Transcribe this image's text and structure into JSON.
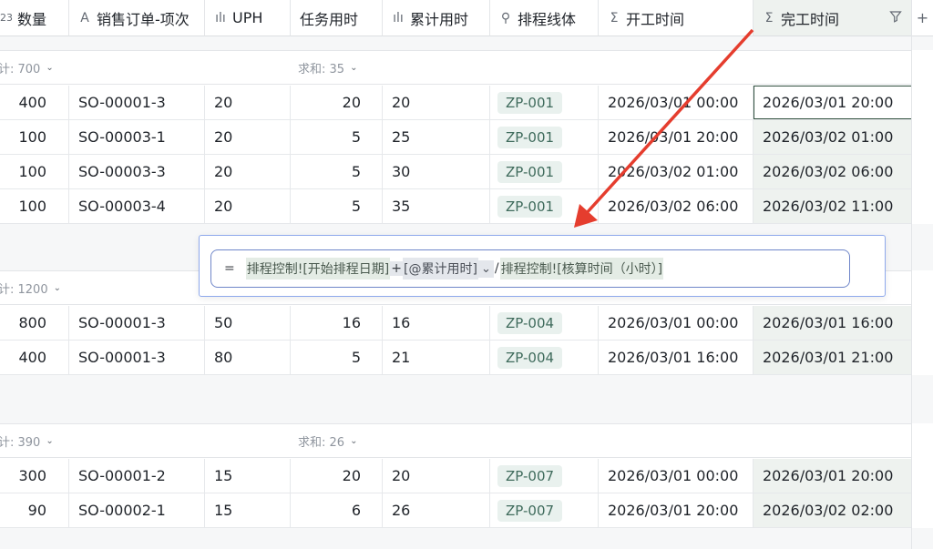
{
  "columns": [
    {
      "icon": "123",
      "icon_name": "number-icon",
      "label": "数量"
    },
    {
      "icon": "A",
      "icon_name": "text-icon",
      "label": "销售订单-项次"
    },
    {
      "icon": "ılı",
      "icon_name": "bar-chart-icon",
      "label": "UPH"
    },
    {
      "icon": "",
      "icon_name": "",
      "label": "任务用时"
    },
    {
      "icon": "ılı",
      "icon_name": "bar-chart-icon",
      "label": "累计用时"
    },
    {
      "icon": "⚲",
      "icon_name": "link-icon",
      "label": "排程线体"
    },
    {
      "icon": "Σ",
      "icon_name": "sigma-icon",
      "label": "开工时间"
    },
    {
      "icon": "Σ",
      "icon_name": "sigma-icon",
      "label": "完工时间"
    }
  ],
  "groups": [
    {
      "sum_qty": "计: 700",
      "sum_time": "求和: 35",
      "rows": [
        {
          "qty": "400",
          "order": "SO-00001-3",
          "uph": "20",
          "task": "20",
          "cum": "20",
          "line": "ZP-001",
          "start": "2026/03/01 00:00",
          "end": "2026/03/01 20:00"
        },
        {
          "qty": "100",
          "order": "SO-00003-1",
          "uph": "20",
          "task": "5",
          "cum": "25",
          "line": "ZP-001",
          "start": "2026/03/01 20:00",
          "end": "2026/03/02 01:00"
        },
        {
          "qty": "100",
          "order": "SO-00003-3",
          "uph": "20",
          "task": "5",
          "cum": "30",
          "line": "ZP-001",
          "start": "2026/03/02 01:00",
          "end": "2026/03/02 06:00"
        },
        {
          "qty": "100",
          "order": "SO-00003-4",
          "uph": "20",
          "task": "5",
          "cum": "35",
          "line": "ZP-001",
          "start": "2026/03/02 06:00",
          "end": "2026/03/02 11:00"
        }
      ]
    },
    {
      "sum_qty": "计: 1200",
      "sum_time": "",
      "rows": [
        {
          "qty": "800",
          "order": "SO-00001-3",
          "uph": "50",
          "task": "16",
          "cum": "16",
          "line": "ZP-004",
          "start": "2026/03/01 00:00",
          "end": "2026/03/01 16:00"
        },
        {
          "qty": "400",
          "order": "SO-00001-3",
          "uph": "80",
          "task": "5",
          "cum": "21",
          "line": "ZP-004",
          "start": "2026/03/01 16:00",
          "end": "2026/03/01 21:00"
        }
      ]
    },
    {
      "sum_qty": "计: 390",
      "sum_time": "求和: 26",
      "rows": [
        {
          "qty": "300",
          "order": "SO-00001-2",
          "uph": "15",
          "task": "20",
          "cum": "20",
          "line": "ZP-007",
          "start": "2026/03/01 00:00",
          "end": "2026/03/01 20:00"
        },
        {
          "qty": "90",
          "order": "SO-00002-1",
          "uph": "15",
          "task": "6",
          "cum": "26",
          "line": "ZP-007",
          "start": "2026/03/01 20:00",
          "end": "2026/03/02 02:00"
        }
      ]
    }
  ],
  "formula": {
    "eq": "=",
    "part1": "排程控制![开始排程日期]",
    "op1": "+",
    "part2": "[@累计用时]",
    "chevron": "⌄",
    "op2": "/",
    "part3": "排程控制![核算时间（小时）]"
  },
  "add_column": "+",
  "filter_icon": "filter-icon",
  "colors": {
    "accent_green": "#2f4f3e",
    "arrow": "#e53d2e",
    "formula_border": "#6f86c9",
    "tag_bg": "#e9f1ee"
  }
}
